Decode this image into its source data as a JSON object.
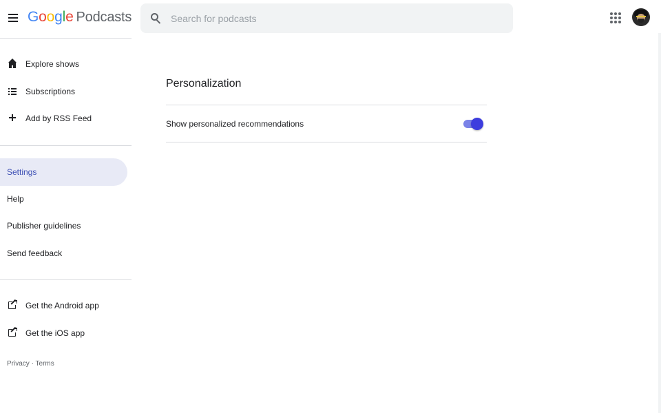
{
  "header": {
    "logo_google_letters": [
      "G",
      "o",
      "o",
      "g",
      "l",
      "e"
    ],
    "logo_google_colors": [
      "#4285F4",
      "#EA4335",
      "#FBBC05",
      "#4285F4",
      "#34A853",
      "#EA4335"
    ],
    "logo_product": "Podcasts",
    "search_placeholder": "Search for podcasts",
    "icons": {
      "menu": "hamburger-menu-icon",
      "search": "search-icon",
      "apps": "apps-grid-icon",
      "avatar": "user-avatar"
    }
  },
  "sidebar": {
    "primary": [
      {
        "label": "Explore shows",
        "icon": "home-icon"
      },
      {
        "label": "Subscriptions",
        "icon": "list-icon"
      },
      {
        "label": "Add by RSS Feed",
        "icon": "plus-icon"
      }
    ],
    "secondary": [
      {
        "label": "Settings",
        "active": true
      },
      {
        "label": "Help"
      },
      {
        "label": "Publisher guidelines"
      },
      {
        "label": "Send feedback"
      }
    ],
    "apps": [
      {
        "label": "Get the Android app",
        "icon": "external-link-icon"
      },
      {
        "label": "Get the iOS app",
        "icon": "external-link-icon"
      }
    ],
    "footer": {
      "privacy": "Privacy",
      "separator": "·",
      "terms": "Terms"
    }
  },
  "main": {
    "section_title": "Personalization",
    "settings": [
      {
        "label": "Show personalized recommendations",
        "enabled": true
      }
    ]
  },
  "colors": {
    "accent": "#3f51b5",
    "active_bg": "#e8eaf6",
    "toggle_thumb": "#3d3dde",
    "toggle_track": "#7b83e8"
  }
}
